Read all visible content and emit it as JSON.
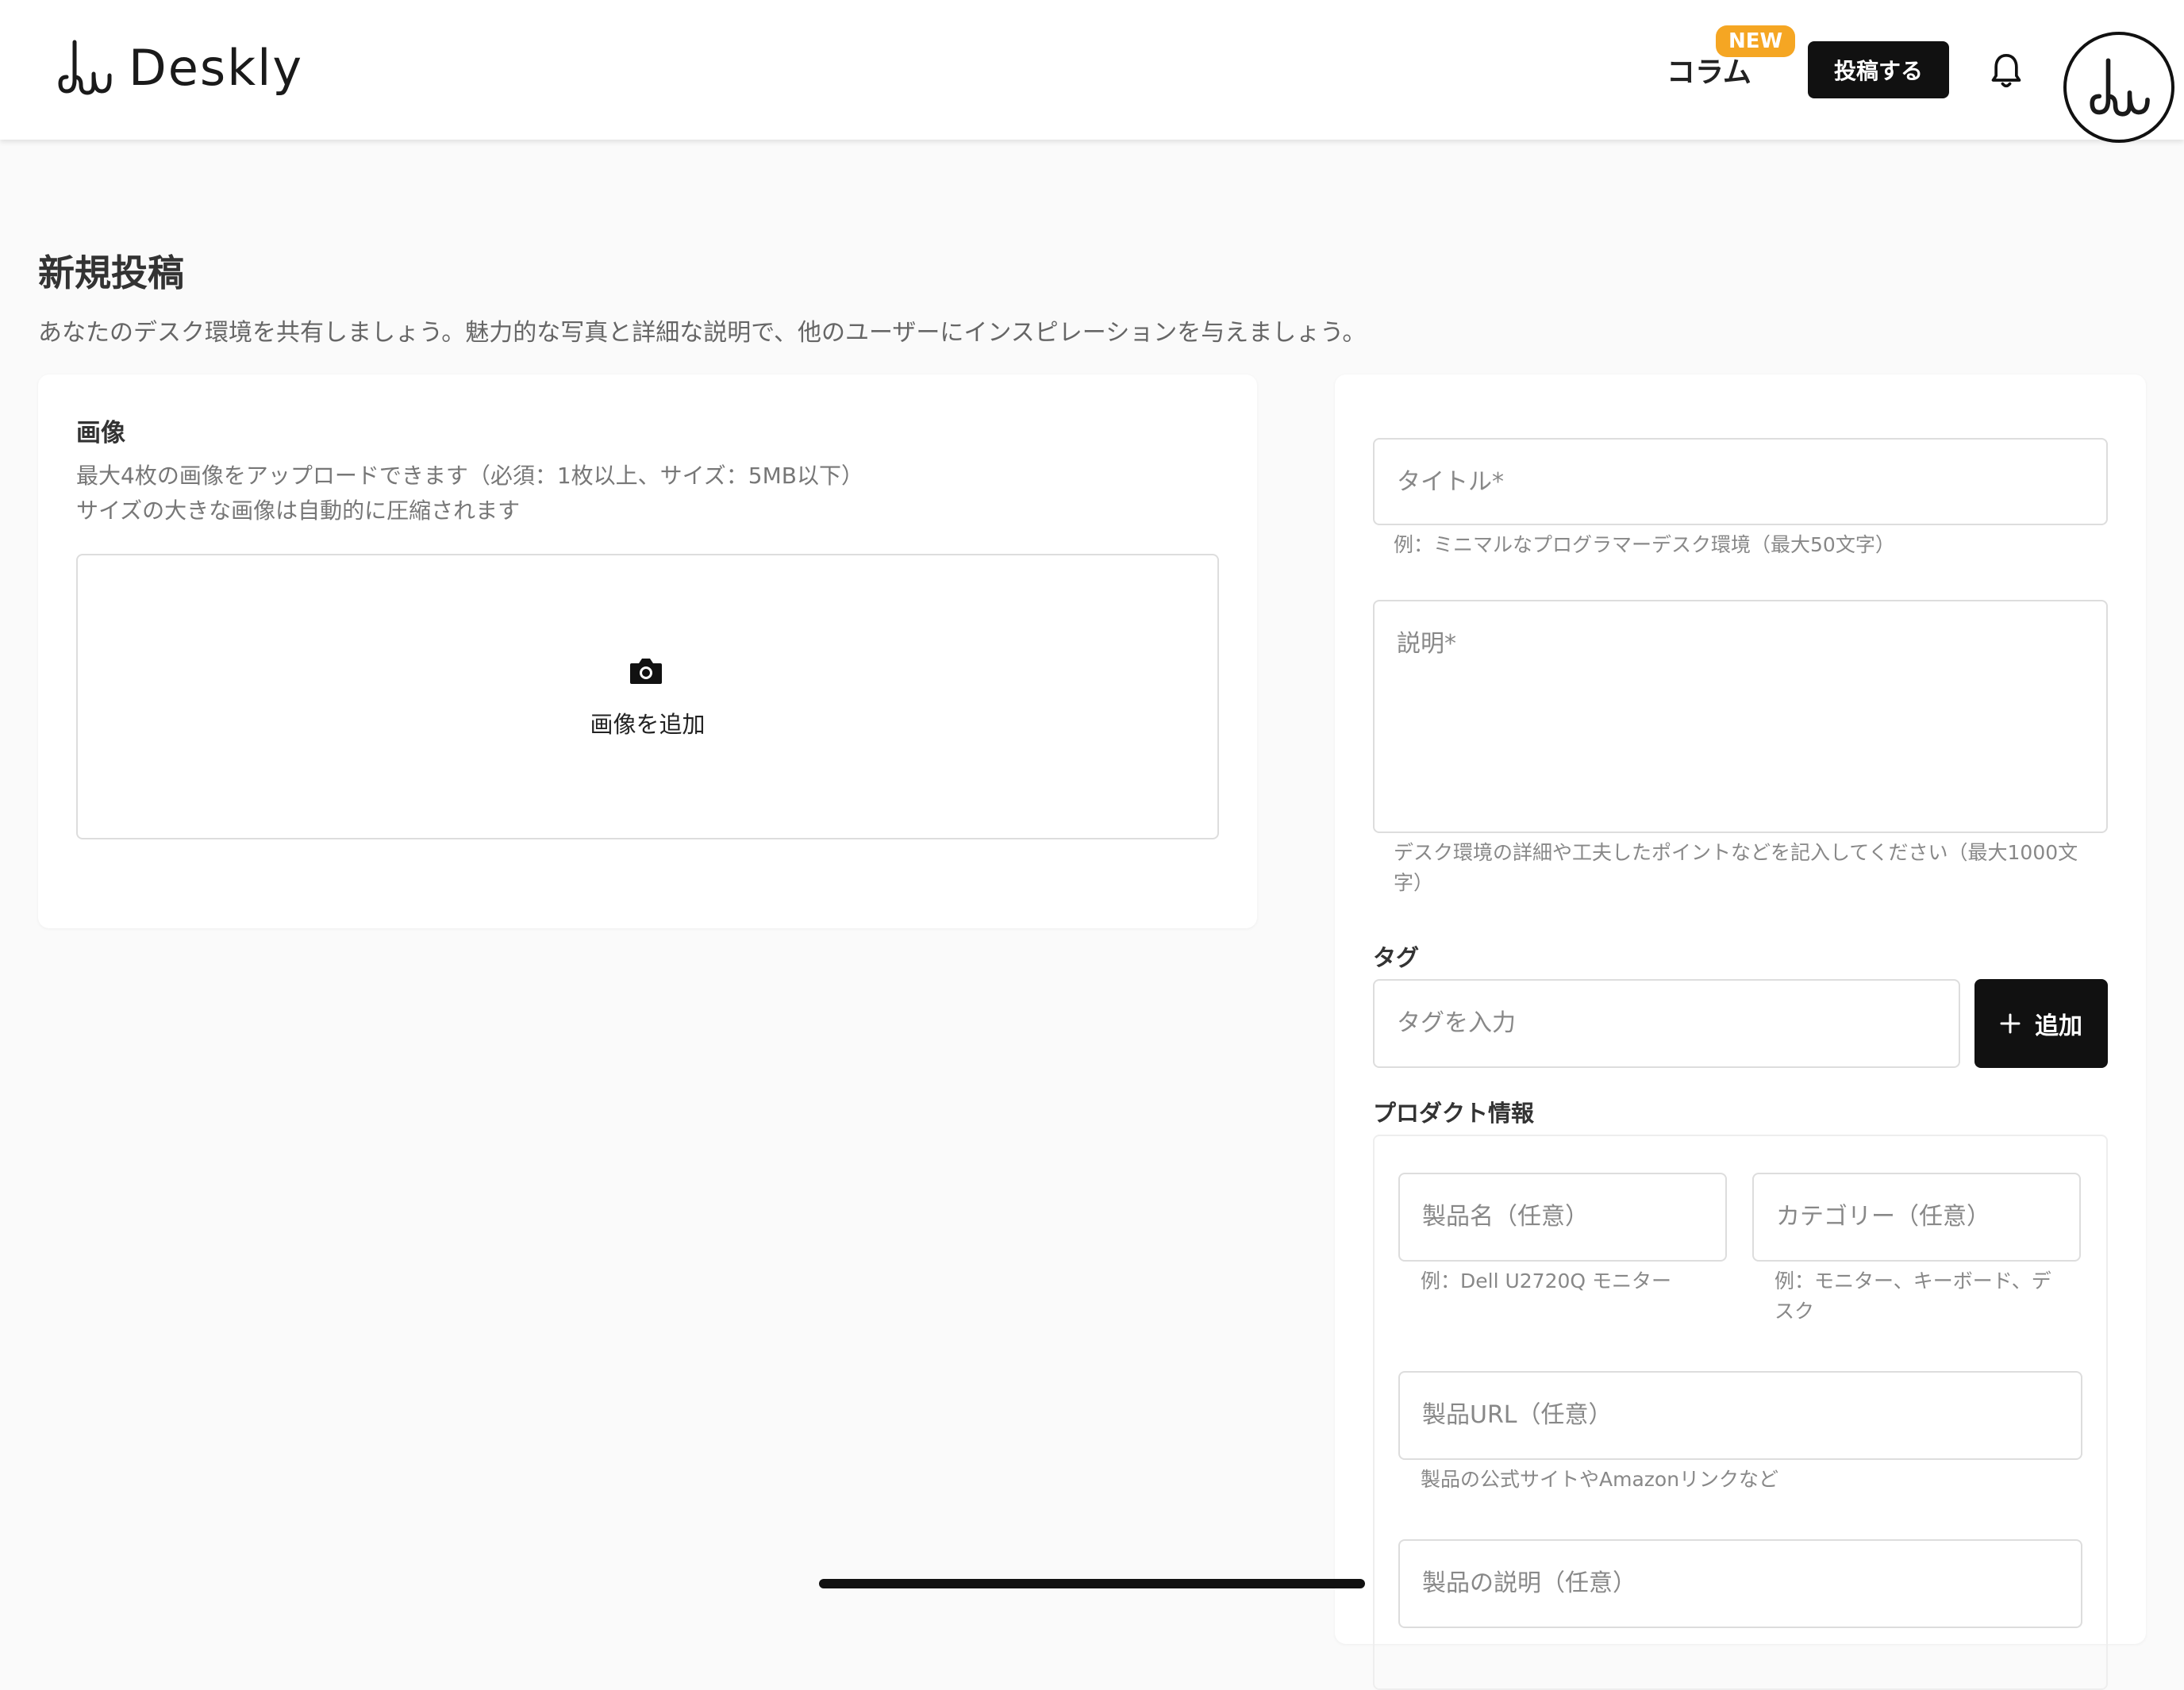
{
  "header": {
    "logo_text": "Deskly",
    "column_label": "コラム",
    "new_badge": "NEW",
    "post_button": "投稿する"
  },
  "page": {
    "title": "新規投稿",
    "subtitle": "あなたのデスク環境を共有しましょう。魅力的な写真と詳細な説明で、他のユーザーにインスピレーションを与えましょう。"
  },
  "images": {
    "section_title": "画像",
    "help_line1": "最大4枚の画像をアップロードできます（必須：1枚以上、サイズ：5MB以下）",
    "help_line2": "サイズの大きな画像は自動的に圧縮されます",
    "add_label": "画像を追加"
  },
  "form": {
    "title_placeholder": "タイトル*",
    "title_help": "例：ミニマルなプログラマーデスク環境（最大50文字）",
    "description_placeholder": "説明*",
    "description_help": "デスク環境の詳細や工夫したポイントなどを記入してください（最大1000文字）",
    "tags_label": "タグ",
    "tag_placeholder": "タグを入力",
    "add_tag_button": "追加"
  },
  "product": {
    "section_title": "プロダクト情報",
    "name_placeholder": "製品名（任意）",
    "name_help": "例：Dell U2720Q モニター",
    "category_placeholder": "カテゴリー（任意）",
    "category_help": "例：モニター、キーボード、デスク",
    "url_placeholder": "製品URL（任意）",
    "url_help": "製品の公式サイトやAmazonリンクなど",
    "desc_placeholder": "製品の説明（任意）"
  },
  "icons": {
    "logo": "deskly-logo-icon",
    "bell": "bell-icon",
    "avatar": "user-avatar-icon",
    "camera": "camera-icon",
    "plus": "plus-icon"
  },
  "colors": {
    "accent_dark": "#111111",
    "badge_orange": "#f5a623",
    "background": "#fafafa"
  }
}
